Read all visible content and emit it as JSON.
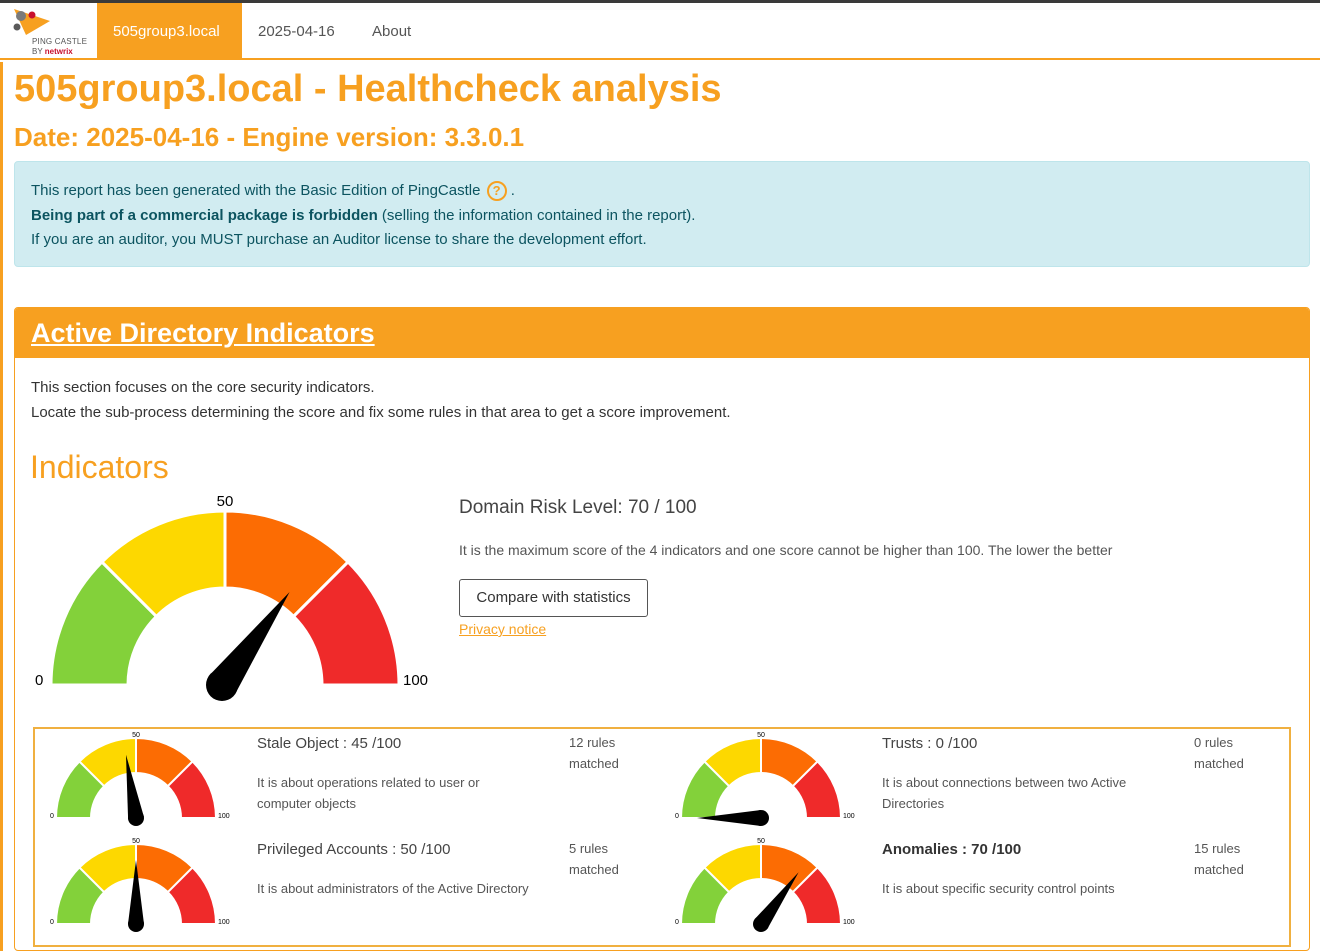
{
  "nav": {
    "brand_line1": "PING CASTLE",
    "brand_line2_prefix": "BY ",
    "brand_line2_brand": "netwrix",
    "tabs": [
      {
        "label": "505group3.local",
        "active": true
      },
      {
        "label": "2025-04-16",
        "active": false
      },
      {
        "label": "About",
        "active": false
      }
    ]
  },
  "header": {
    "title": "505group3.local - Healthcheck analysis",
    "subtitle": "Date: 2025-04-16 - Engine version: 3.3.0.1"
  },
  "notice": {
    "line1": "This report has been generated with the Basic Edition of PingCastle",
    "help_glyph": "?",
    "line1_end": ".",
    "line2_bold": "Being part of a commercial package is forbidden",
    "line2_rest": " (selling the information contained in the report).",
    "line3": "If you are an auditor, you MUST purchase an Auditor license to share the development effort."
  },
  "section": {
    "title": "Active Directory Indicators",
    "desc_line1": "This section focuses on the core security indicators.",
    "desc_line2": "Locate the sub-process determining the score and fix some rules in that area to get a score improvement.",
    "indicators_title": "Indicators"
  },
  "domain_risk": {
    "title": "Domain Risk Level: 70 / 100",
    "value": 70,
    "description": "It is the maximum score of the 4 indicators and one score cannot be higher than 100. The lower the better",
    "compare_button": "Compare with statistics",
    "privacy_link": "Privacy notice"
  },
  "gauge_labels": {
    "min": "0",
    "mid": "50",
    "max": "100"
  },
  "colors": {
    "accent": "#f7a020",
    "green": "#83d13a",
    "yellow": "#fdd800",
    "orange": "#fc6c03",
    "red": "#ef2a2a",
    "needle": "#000000"
  },
  "indicators": [
    {
      "title": "Stale Object : 45 /100",
      "score": 45,
      "rules_line1": "12 rules",
      "rules_line2": "matched",
      "desc_line1": "It is about operations related to user or",
      "desc_line2": "computer objects",
      "highlight": false
    },
    {
      "title": "Trusts : 0 /100",
      "score": 0,
      "rules_line1": "0 rules",
      "rules_line2": "matched",
      "desc_line1": "It is about connections between two Active",
      "desc_line2": "Directories",
      "highlight": false
    },
    {
      "title": "Privileged Accounts : 50 /100",
      "score": 50,
      "rules_line1": "5 rules",
      "rules_line2": "matched",
      "desc_line1": "It is about administrators of the Active Directory",
      "desc_line2": "",
      "highlight": false
    },
    {
      "title": "Anomalies : 70 /100",
      "score": 70,
      "rules_line1": "15 rules",
      "rules_line2": "matched",
      "desc_line1": "It is about specific security control points",
      "desc_line2": "",
      "highlight": true
    }
  ]
}
